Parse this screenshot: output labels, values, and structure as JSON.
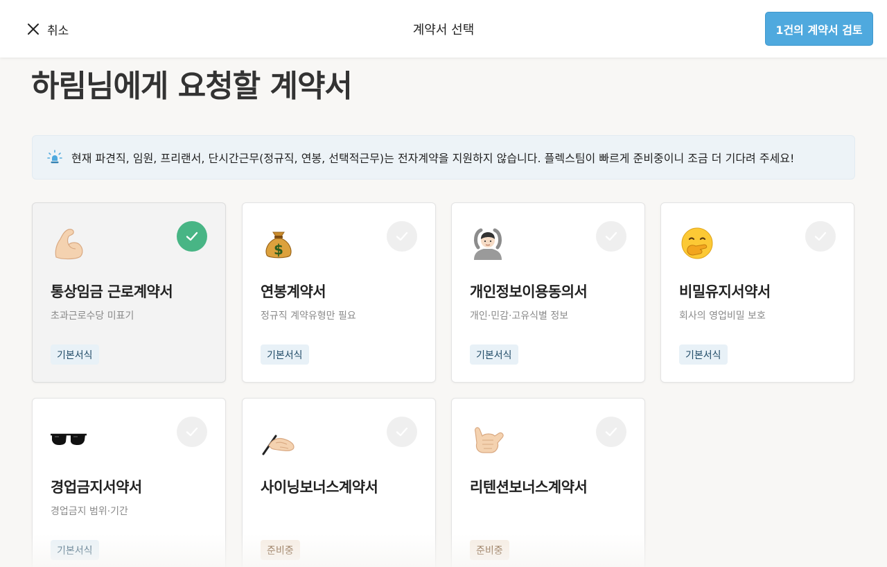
{
  "header": {
    "cancel_label": "취소",
    "title": "계약서 선택",
    "review_button_label": "1건의 계약서 검토"
  },
  "page": {
    "heading": "하림님에게 요청할 계약서",
    "notice": "현재 파견직, 임원, 프리랜서, 단시간근무(정규직, 연봉, 선택적근무)는 전자계약을 지원하지 않습니다. 플렉스팀이 빠르게 준비중이니 조금 더 기다려 주세요!"
  },
  "colors": {
    "accent": "#4fa9de",
    "selected_check": "#48b585",
    "badge_basic_bg": "#e8f1f7",
    "badge_prep_bg": "#f6ece2"
  },
  "contracts": [
    {
      "icon": "flexed-biceps-icon",
      "name": "통상임금 근로계약서",
      "sub": "초과근로수당 미표기",
      "badge": "기본서식",
      "selected": true
    },
    {
      "icon": "money-bag-icon",
      "name": "연봉계약서",
      "sub": "정규직 계약유형만 필요",
      "badge": "기본서식",
      "selected": false
    },
    {
      "icon": "person-ok-gesture-icon",
      "name": "개인정보이용동의서",
      "sub": "개인·민감·고유식별 정보",
      "badge": "기본서식",
      "selected": false
    },
    {
      "icon": "hand-over-mouth-icon",
      "name": "비밀유지서약서",
      "sub": "회사의 영업비밀 보호",
      "badge": "기본서식",
      "selected": false
    },
    {
      "icon": "sunglasses-icon",
      "name": "경업금지서약서",
      "sub": "경업금지 범위·기간",
      "badge": "기본서식",
      "selected": false
    },
    {
      "icon": "writing-hand-icon",
      "name": "사이닝보너스계약서",
      "sub": "",
      "badge": "준비중",
      "selected": false
    },
    {
      "icon": "call-me-hand-icon",
      "name": "리텐션보너스계약서",
      "sub": "",
      "badge": "준비중",
      "selected": false
    }
  ]
}
